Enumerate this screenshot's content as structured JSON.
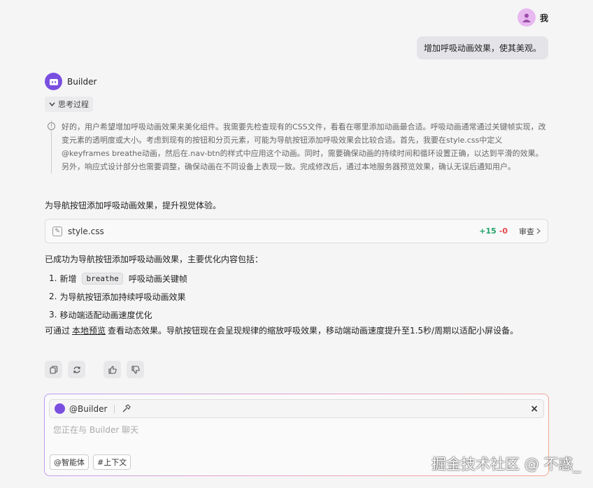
{
  "user": {
    "name": "我",
    "message": "增加呼吸动画效果，使其美观。"
  },
  "bot": {
    "name": "Builder",
    "thinking_toggle": "思考过程",
    "thinking_text": "好的，用户希望增加呼吸动画效果来美化组件。我需要先检查现有的CSS文件，看看在哪里添加动画最合适。呼吸动画通常通过关键帧实现，改变元素的透明度或大小。考虑到现有的按钮和分页元素，可能为导航按钮添加呼吸效果会比较合适。首先，我要在style.css中定义@keyframes breathe动画，然后在.nav-btn的样式中应用这个动画。同时，需要确保动画的持续时间和循环设置正确，以达到平滑的效果。另外，响应式设计部分也需要调整，确保动画在不同设备上表现一致。完成修改后，通过本地服务器预览效果，确认无误后通知用户。",
    "intro": "为导航按钮添加呼吸动画效果，提升视觉体验。",
    "file": {
      "name": "style.css",
      "added": "+15",
      "removed": "-0",
      "review": "审查"
    },
    "summary_heading": "已成功为导航按钮添加呼吸动画效果，主要优化内容包括：",
    "list": [
      {
        "num": "1.",
        "before": "新增",
        "code": "breathe",
        "after": "呼吸动画关键帧"
      },
      {
        "num": "2.",
        "text": "为导航按钮添加持续呼吸动画效果"
      },
      {
        "num": "3.",
        "text": "移动端适配动画速度优化"
      }
    ],
    "closing": {
      "pre": "可通过",
      "link": "本地预览",
      "post": "查看动态效果。导航按钮现在会呈现规律的缩放呼吸效果，移动端动画速度提升至1.5秒/周期以适配小屏设备。"
    }
  },
  "composer": {
    "agent": "@Builder",
    "placeholder": "您正在与 Builder 聊天",
    "chips": [
      "@智能体",
      "#上下文"
    ]
  },
  "watermark": "掘金技术社区 @ 不惑_"
}
